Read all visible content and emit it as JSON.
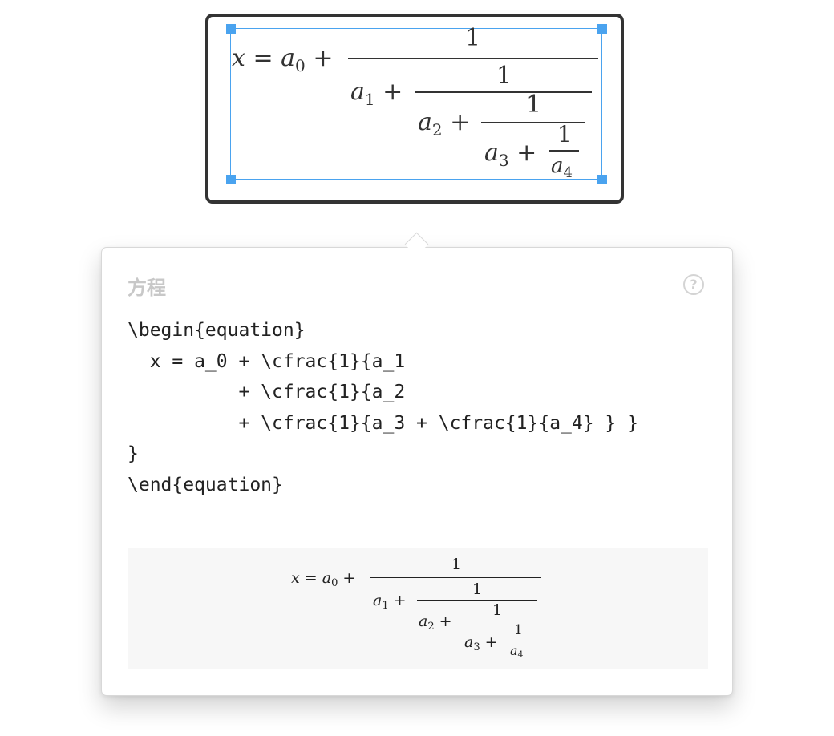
{
  "editor": {
    "equation": {
      "lhs": "x",
      "equals": "=",
      "plus": "+",
      "one": "1",
      "a": "a",
      "sub0": "0",
      "sub1": "1",
      "sub2": "2",
      "sub3": "3",
      "sub4": "4"
    }
  },
  "popover": {
    "title": "方程",
    "help_icon": "?",
    "code_lines": [
      "\\begin{equation}",
      "  x = a_0 + \\cfrac{1}{a_1",
      "          + \\cfrac{1}{a_2",
      "          + \\cfrac{1}{a_3 + \\cfrac{1}{a_4} } }",
      "}",
      "\\end{equation}"
    ]
  },
  "colors": {
    "selection": "#4aa3ef",
    "block_border": "#333333",
    "title_gray": "#c8c8c8",
    "preview_bg": "#f7f7f7"
  }
}
